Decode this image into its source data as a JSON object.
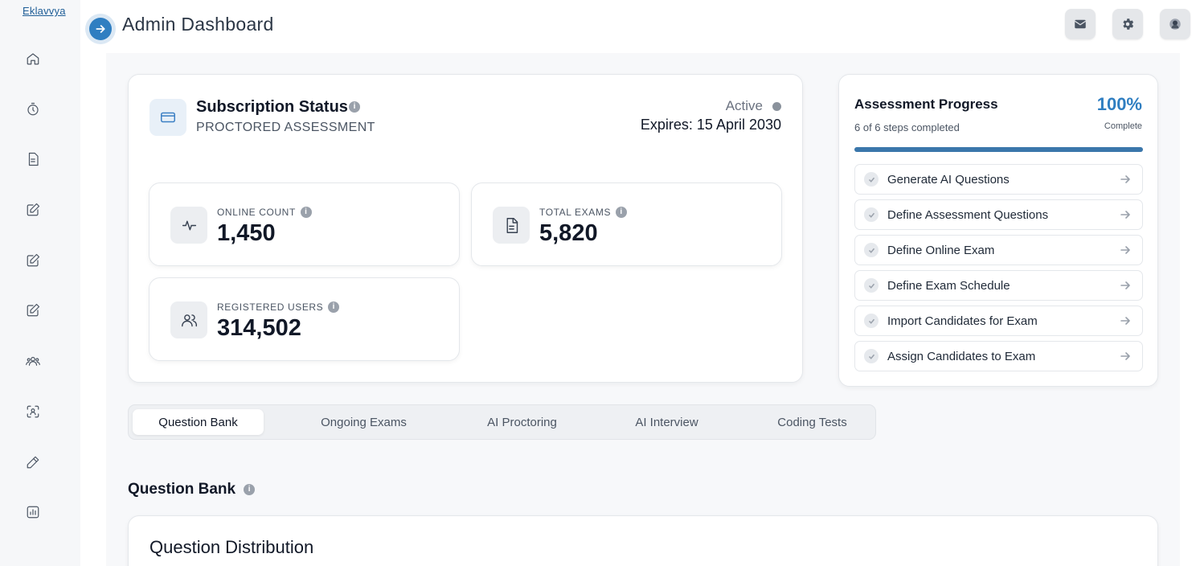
{
  "brand": "Eklavvya",
  "header": {
    "title": "Admin Dashboard"
  },
  "subscription": {
    "title": "Subscription Status",
    "type": "PROCTORED ASSESSMENT",
    "status": "Active",
    "expires": "Expires: 15 April 2030"
  },
  "stats": {
    "online": {
      "label": "ONLINE COUNT",
      "value": "1,450"
    },
    "exams": {
      "label": "TOTAL EXAMS",
      "value": "5,820"
    },
    "users": {
      "label": "REGISTERED USERS",
      "value": "314,502"
    }
  },
  "progress": {
    "title": "Assessment Progress",
    "subtitle": "6 of 6 steps completed",
    "percent_text": "100%",
    "complete_label": "Complete",
    "fraction": 1.0,
    "steps": [
      {
        "label": "Generate AI Questions"
      },
      {
        "label": "Define Assessment Questions"
      },
      {
        "label": "Define Online Exam"
      },
      {
        "label": "Define Exam Schedule"
      },
      {
        "label": "Import Candidates for Exam"
      },
      {
        "label": "Assign Candidates to Exam"
      }
    ]
  },
  "tabs": [
    {
      "label": "Question Bank",
      "active": true
    },
    {
      "label": "Ongoing Exams"
    },
    {
      "label": "AI Proctoring"
    },
    {
      "label": "AI Interview"
    },
    {
      "label": "Coding Tests"
    }
  ],
  "section": {
    "title": "Question Bank",
    "card_title": "Question Distribution"
  },
  "colors": {
    "accent": "#2f7ec1",
    "progress_fill": "#3b77ab"
  }
}
